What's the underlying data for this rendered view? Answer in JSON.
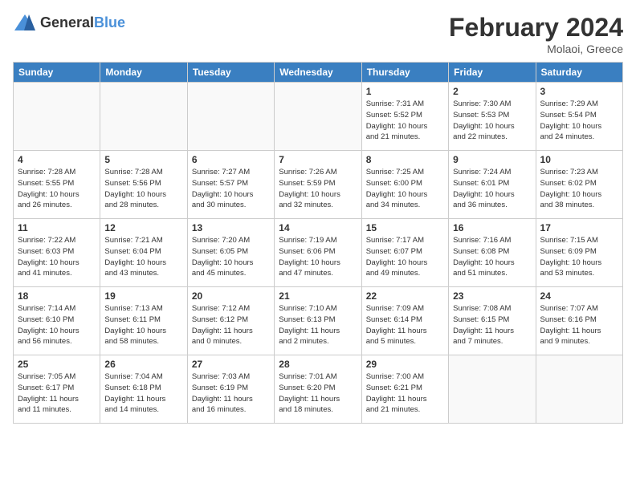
{
  "logo": {
    "general": "General",
    "blue": "Blue"
  },
  "title": {
    "month_year": "February 2024",
    "location": "Molaoi, Greece"
  },
  "weekdays": [
    "Sunday",
    "Monday",
    "Tuesday",
    "Wednesday",
    "Thursday",
    "Friday",
    "Saturday"
  ],
  "weeks": [
    [
      {
        "day": "",
        "info": ""
      },
      {
        "day": "",
        "info": ""
      },
      {
        "day": "",
        "info": ""
      },
      {
        "day": "",
        "info": ""
      },
      {
        "day": "1",
        "info": "Sunrise: 7:31 AM\nSunset: 5:52 PM\nDaylight: 10 hours\nand 21 minutes."
      },
      {
        "day": "2",
        "info": "Sunrise: 7:30 AM\nSunset: 5:53 PM\nDaylight: 10 hours\nand 22 minutes."
      },
      {
        "day": "3",
        "info": "Sunrise: 7:29 AM\nSunset: 5:54 PM\nDaylight: 10 hours\nand 24 minutes."
      }
    ],
    [
      {
        "day": "4",
        "info": "Sunrise: 7:28 AM\nSunset: 5:55 PM\nDaylight: 10 hours\nand 26 minutes."
      },
      {
        "day": "5",
        "info": "Sunrise: 7:28 AM\nSunset: 5:56 PM\nDaylight: 10 hours\nand 28 minutes."
      },
      {
        "day": "6",
        "info": "Sunrise: 7:27 AM\nSunset: 5:57 PM\nDaylight: 10 hours\nand 30 minutes."
      },
      {
        "day": "7",
        "info": "Sunrise: 7:26 AM\nSunset: 5:59 PM\nDaylight: 10 hours\nand 32 minutes."
      },
      {
        "day": "8",
        "info": "Sunrise: 7:25 AM\nSunset: 6:00 PM\nDaylight: 10 hours\nand 34 minutes."
      },
      {
        "day": "9",
        "info": "Sunrise: 7:24 AM\nSunset: 6:01 PM\nDaylight: 10 hours\nand 36 minutes."
      },
      {
        "day": "10",
        "info": "Sunrise: 7:23 AM\nSunset: 6:02 PM\nDaylight: 10 hours\nand 38 minutes."
      }
    ],
    [
      {
        "day": "11",
        "info": "Sunrise: 7:22 AM\nSunset: 6:03 PM\nDaylight: 10 hours\nand 41 minutes."
      },
      {
        "day": "12",
        "info": "Sunrise: 7:21 AM\nSunset: 6:04 PM\nDaylight: 10 hours\nand 43 minutes."
      },
      {
        "day": "13",
        "info": "Sunrise: 7:20 AM\nSunset: 6:05 PM\nDaylight: 10 hours\nand 45 minutes."
      },
      {
        "day": "14",
        "info": "Sunrise: 7:19 AM\nSunset: 6:06 PM\nDaylight: 10 hours\nand 47 minutes."
      },
      {
        "day": "15",
        "info": "Sunrise: 7:17 AM\nSunset: 6:07 PM\nDaylight: 10 hours\nand 49 minutes."
      },
      {
        "day": "16",
        "info": "Sunrise: 7:16 AM\nSunset: 6:08 PM\nDaylight: 10 hours\nand 51 minutes."
      },
      {
        "day": "17",
        "info": "Sunrise: 7:15 AM\nSunset: 6:09 PM\nDaylight: 10 hours\nand 53 minutes."
      }
    ],
    [
      {
        "day": "18",
        "info": "Sunrise: 7:14 AM\nSunset: 6:10 PM\nDaylight: 10 hours\nand 56 minutes."
      },
      {
        "day": "19",
        "info": "Sunrise: 7:13 AM\nSunset: 6:11 PM\nDaylight: 10 hours\nand 58 minutes."
      },
      {
        "day": "20",
        "info": "Sunrise: 7:12 AM\nSunset: 6:12 PM\nDaylight: 11 hours\nand 0 minutes."
      },
      {
        "day": "21",
        "info": "Sunrise: 7:10 AM\nSunset: 6:13 PM\nDaylight: 11 hours\nand 2 minutes."
      },
      {
        "day": "22",
        "info": "Sunrise: 7:09 AM\nSunset: 6:14 PM\nDaylight: 11 hours\nand 5 minutes."
      },
      {
        "day": "23",
        "info": "Sunrise: 7:08 AM\nSunset: 6:15 PM\nDaylight: 11 hours\nand 7 minutes."
      },
      {
        "day": "24",
        "info": "Sunrise: 7:07 AM\nSunset: 6:16 PM\nDaylight: 11 hours\nand 9 minutes."
      }
    ],
    [
      {
        "day": "25",
        "info": "Sunrise: 7:05 AM\nSunset: 6:17 PM\nDaylight: 11 hours\nand 11 minutes."
      },
      {
        "day": "26",
        "info": "Sunrise: 7:04 AM\nSunset: 6:18 PM\nDaylight: 11 hours\nand 14 minutes."
      },
      {
        "day": "27",
        "info": "Sunrise: 7:03 AM\nSunset: 6:19 PM\nDaylight: 11 hours\nand 16 minutes."
      },
      {
        "day": "28",
        "info": "Sunrise: 7:01 AM\nSunset: 6:20 PM\nDaylight: 11 hours\nand 18 minutes."
      },
      {
        "day": "29",
        "info": "Sunrise: 7:00 AM\nSunset: 6:21 PM\nDaylight: 11 hours\nand 21 minutes."
      },
      {
        "day": "",
        "info": ""
      },
      {
        "day": "",
        "info": ""
      }
    ]
  ]
}
